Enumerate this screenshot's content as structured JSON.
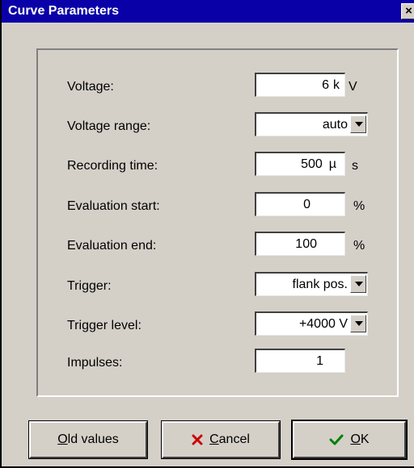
{
  "window": {
    "title": "Curve Parameters",
    "close_label": "×"
  },
  "fields": {
    "voltage": {
      "label": "Voltage:",
      "value": "6",
      "prefix": "k",
      "unit": "V"
    },
    "voltage_range": {
      "label": "Voltage range:",
      "value": "auto"
    },
    "recording_time": {
      "label": "Recording time:",
      "value": "500",
      "prefix": "µ",
      "unit": "s"
    },
    "evaluation_start": {
      "label": "Evaluation start:",
      "value": "0",
      "unit": "%"
    },
    "evaluation_end": {
      "label": "Evaluation end:",
      "value": "100",
      "unit": "%"
    },
    "trigger": {
      "label": "Trigger:",
      "value": "flank pos."
    },
    "trigger_level": {
      "label": "Trigger level:",
      "value": "+4000 V"
    },
    "impulses": {
      "label": "Impulses:",
      "value": "1"
    }
  },
  "buttons": {
    "old_values": {
      "mnemonic": "O",
      "rest": "ld values"
    },
    "cancel": {
      "mnemonic": "C",
      "rest": "ancel"
    },
    "ok": {
      "mnemonic": "O",
      "rest": "K"
    }
  },
  "colors": {
    "titlebar": "#0a00a8",
    "dialog_bg": "#d4d0c8",
    "cancel_icon": "#cc0000",
    "ok_icon": "#008000"
  },
  "icons": {
    "close": "close-icon",
    "dropdown": "chevron-down-icon",
    "cancel": "x-mark-icon",
    "ok": "check-mark-icon"
  }
}
